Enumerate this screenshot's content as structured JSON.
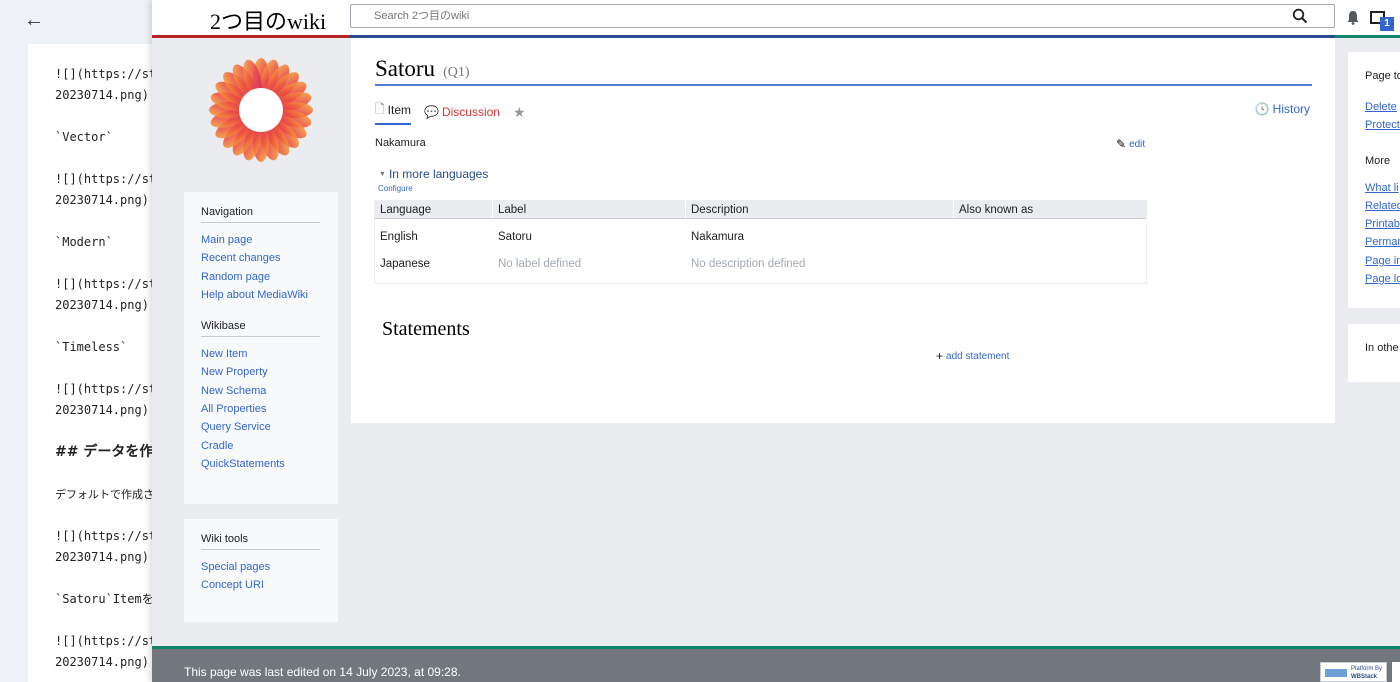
{
  "editor": {
    "lines": [
      {
        "kind": "code",
        "text": "![](https://storage"
      },
      {
        "kind": "code",
        "text": "20230714.png)"
      },
      {
        "kind": "gap"
      },
      {
        "kind": "code",
        "text": "`Vector`"
      },
      {
        "kind": "gap"
      },
      {
        "kind": "code",
        "text": "![](https://storage"
      },
      {
        "kind": "code",
        "text": "20230714.png)"
      },
      {
        "kind": "gap"
      },
      {
        "kind": "code",
        "text": "`Modern`"
      },
      {
        "kind": "gap"
      },
      {
        "kind": "code",
        "text": "![](https://storage"
      },
      {
        "kind": "code",
        "text": "20230714.png)"
      },
      {
        "kind": "gap"
      },
      {
        "kind": "code",
        "text": "`Timeless`"
      },
      {
        "kind": "gap"
      },
      {
        "kind": "code",
        "text": "![](https://storage"
      },
      {
        "kind": "code",
        "text": "20230714.png)"
      },
      {
        "kind": "gap"
      },
      {
        "kind": "heading",
        "text": "## データを作成"
      },
      {
        "kind": "gap"
      },
      {
        "kind": "plain",
        "text": "デフォルトで作成される"
      },
      {
        "kind": "gap"
      },
      {
        "kind": "code",
        "text": "![](https://storage"
      },
      {
        "kind": "code",
        "text": "20230714.png)"
      },
      {
        "kind": "gap"
      },
      {
        "kind": "code",
        "text": "`Satoru`Itemを作成"
      },
      {
        "kind": "gap"
      },
      {
        "kind": "code",
        "text": "![](https://storage"
      },
      {
        "kind": "code",
        "text": "20230714.png)"
      }
    ]
  },
  "header": {
    "site_title": "2つ目のwiki",
    "search_placeholder": "Search 2つ目のwiki",
    "notification_count": "1"
  },
  "sidebar": {
    "navigation_title": "Navigation",
    "navigation": [
      "Main page",
      "Recent changes",
      "Random page",
      "Help about MediaWiki"
    ],
    "wikibase_title": "Wikibase",
    "wikibase": [
      "New Item",
      "New Property",
      "New Schema",
      "All Properties",
      "Query Service",
      "Cradle",
      "QuickStatements"
    ],
    "tools_title": "Wiki tools",
    "tools": [
      "Special pages",
      "Concept URI"
    ]
  },
  "page": {
    "title": "Satoru",
    "qid": "(Q1)",
    "tabs": {
      "item": "Item",
      "discussion": "Discussion",
      "history": "History"
    },
    "description": "Nakamura",
    "edit_label": "edit",
    "more_languages": "In more languages",
    "configure": "Configure",
    "table_headers": [
      "Language",
      "Label",
      "Description",
      "Also known as"
    ],
    "table_rows": [
      {
        "language": "English",
        "label": "Satoru",
        "description": "Nakamura",
        "aliases": "",
        "label_muted": false,
        "desc_muted": false
      },
      {
        "language": "Japanese",
        "label": "No label defined",
        "description": "No description defined",
        "aliases": "",
        "label_muted": true,
        "desc_muted": true
      }
    ],
    "statements_heading": "Statements",
    "add_statement": "add statement"
  },
  "right_panel": {
    "page_tools_title": "Page to",
    "page_tools": [
      "Delete",
      "Protect"
    ],
    "more_title": "More",
    "more": [
      "What li",
      "Related",
      "Printab",
      "Perman",
      "Page in",
      "Page lo"
    ],
    "other_title": "In othe"
  },
  "footer": {
    "last_edited": "This page was last edited on 14 July 2023, at 09:28.",
    "badge_line1": "Platform By",
    "badge_line2": "WBStack"
  },
  "colors": {
    "link": "#3366cc",
    "stripe_red": "#b32424",
    "stripe_blue": "#2a4b8d",
    "stripe_green": "#14866d",
    "footer_bg": "#72777d"
  }
}
